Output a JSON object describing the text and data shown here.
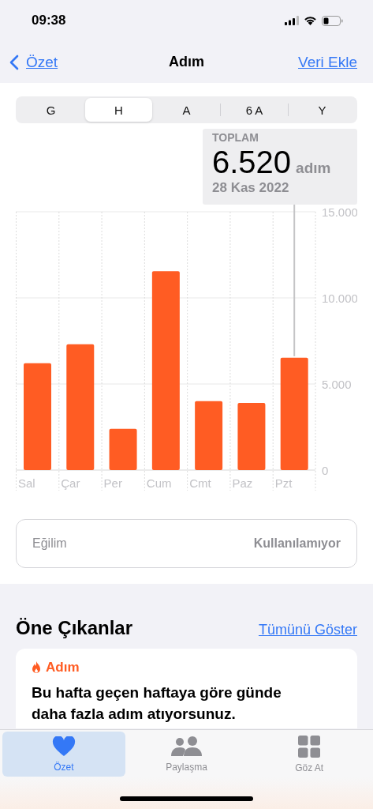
{
  "status_bar": {
    "time": "09:38"
  },
  "nav": {
    "back": "Özet",
    "title": "Adım",
    "action": "Veri Ekle"
  },
  "segments": [
    {
      "label": "G",
      "selected": false
    },
    {
      "label": "H",
      "selected": true
    },
    {
      "label": "A",
      "selected": false
    },
    {
      "label": "6 A",
      "selected": false
    },
    {
      "label": "Y",
      "selected": false
    }
  ],
  "summary": {
    "label": "TOPLAM",
    "value": "6.520",
    "unit": "adım",
    "date": "28 Kas 2022"
  },
  "chart_data": {
    "type": "bar",
    "categories": [
      "Sal",
      "Çar",
      "Per",
      "Cum",
      "Cmt",
      "Paz",
      "Pzt"
    ],
    "values": [
      6200,
      7300,
      2400,
      11550,
      4000,
      3900,
      6520
    ],
    "ylim": [
      0,
      15000
    ],
    "yticks": [
      {
        "value": 0,
        "label": "0"
      },
      {
        "value": 5000,
        "label": "5.000"
      },
      {
        "value": 10000,
        "label": "10.000"
      },
      {
        "value": 15000,
        "label": "15.000"
      }
    ]
  },
  "trend": {
    "label": "Eğilim",
    "value": "Kullanılamıyor"
  },
  "highlights": {
    "title": "Öne Çıkanlar",
    "link": "Tümünü Göster",
    "cards": [
      {
        "category": "Adım",
        "text": "Bu hafta geçen haftaya göre günde daha fazla adım atıyorsunuz."
      }
    ]
  },
  "tab_bar": [
    {
      "label": "Özet",
      "kind": "heart",
      "selected": true
    },
    {
      "label": "Paylaşma",
      "kind": "people",
      "selected": false
    },
    {
      "label": "Göz At",
      "kind": "grid",
      "selected": false
    }
  ]
}
